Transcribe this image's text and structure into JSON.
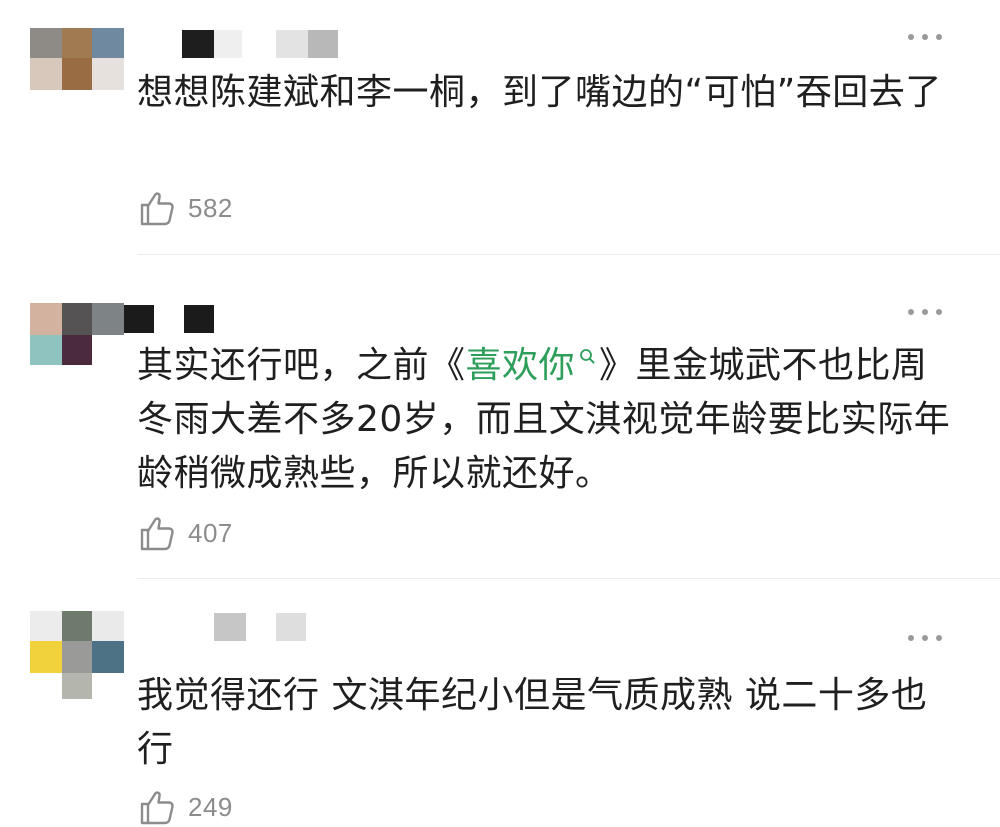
{
  "colors": {
    "text": "#1f1f1f",
    "muted": "#8c8c8c",
    "link": "#2e9e5b",
    "divider": "#ebebeb"
  },
  "comments": [
    {
      "text": "想想陈建斌和李一桐，到了嘴边的“可怕”吞回去了",
      "likes": "582",
      "like_icon": "thumbs-up-icon",
      "more_icon": "more-dots-icon"
    },
    {
      "text_before": "其实还行吧，之前《",
      "link_text": "喜欢你",
      "link_icon": "search-icon",
      "text_after": "》里金城武不也比周冬雨大差不多20岁，而且文淇视觉年龄要比实际年龄稍微成熟些，所以就还好。",
      "likes": "407",
      "like_icon": "thumbs-up-icon",
      "more_icon": "more-dots-icon"
    },
    {
      "text": "我觉得还行 文淇年纪小但是气质成熟 说二十多也行",
      "likes": "249",
      "like_icon": "thumbs-up-icon",
      "more_icon": "more-dots-icon"
    }
  ]
}
